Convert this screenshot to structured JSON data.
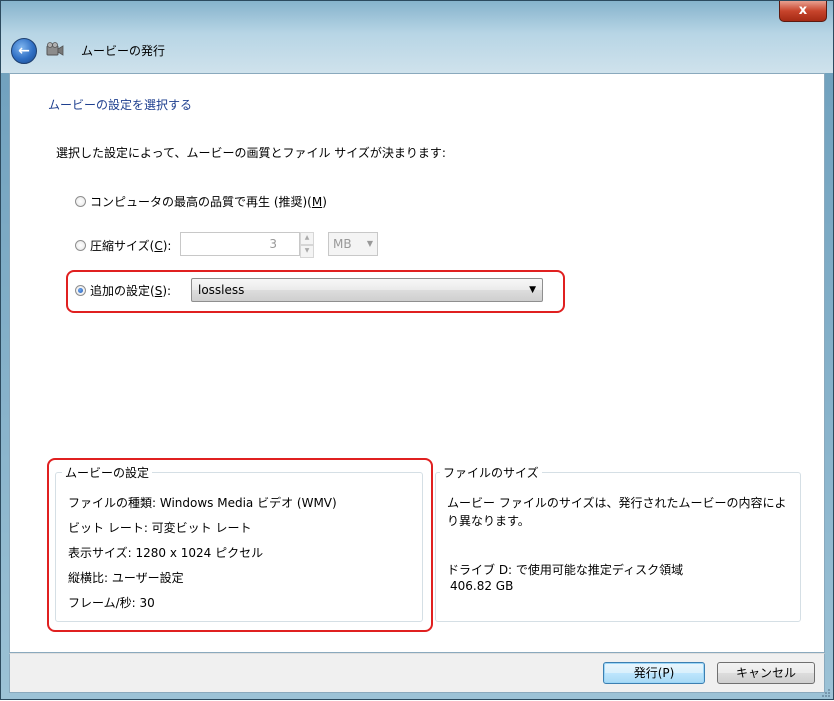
{
  "window": {
    "title": "ムービーの発行",
    "close_glyph": "x"
  },
  "page": {
    "heading": "ムービーの設定を選択する",
    "description": "選択した設定によって、ムービーの画質とファイル サイズが決まります:"
  },
  "options": {
    "best_quality": {
      "label_pre": "コンピュータの最高の品質で再生 (推奨)(",
      "mnemonic": "M",
      "label_post": ")",
      "selected": false
    },
    "compressed_size": {
      "label_pre": "圧縮サイズ(",
      "mnemonic": "C",
      "label_post": "):",
      "selected": false,
      "value": "3",
      "unit": "MB"
    },
    "additional": {
      "label_pre": "追加の設定(",
      "mnemonic": "S",
      "label_post": "):",
      "selected": true,
      "value": "lossless"
    }
  },
  "movie_settings": {
    "title": "ムービーの設定",
    "file_type": "ファイルの種類: Windows Media ビデオ (WMV)",
    "bit_rate": "ビット レート: 可変ビット レート",
    "display_size": "表示サイズ: 1280 x 1024 ピクセル",
    "aspect_ratio": "縦横比: ユーザー設定",
    "frame_rate": "フレーム/秒: 30"
  },
  "file_size": {
    "title": "ファイルのサイズ",
    "note_line1": "ムービー ファイルのサイズは、発行されたムービーの内容によ",
    "note_line2": "り異なります。",
    "disk_label": "ドライブ D: で使用可能な推定ディスク領域",
    "disk_value": "406.82 GB"
  },
  "buttons": {
    "publish": "発行(P)",
    "cancel": "キャンセル"
  },
  "colors": {
    "highlight": "#e02020",
    "heading": "#1e3f8f"
  }
}
